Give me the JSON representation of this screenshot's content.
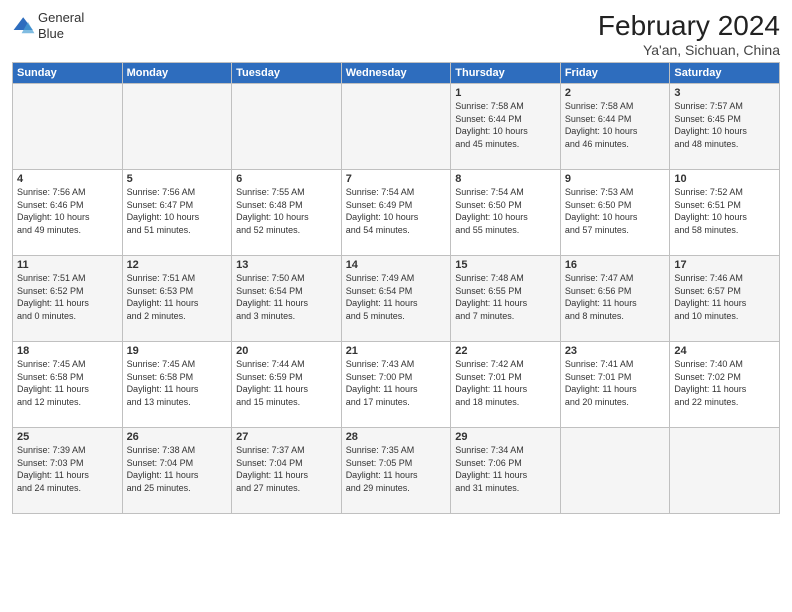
{
  "logo": {
    "line1": "General",
    "line2": "Blue"
  },
  "title": "February 2024",
  "subtitle": "Ya'an, Sichuan, China",
  "days_of_week": [
    "Sunday",
    "Monday",
    "Tuesday",
    "Wednesday",
    "Thursday",
    "Friday",
    "Saturday"
  ],
  "weeks": [
    [
      {
        "num": "",
        "info": ""
      },
      {
        "num": "",
        "info": ""
      },
      {
        "num": "",
        "info": ""
      },
      {
        "num": "",
        "info": ""
      },
      {
        "num": "1",
        "info": "Sunrise: 7:58 AM\nSunset: 6:44 PM\nDaylight: 10 hours\nand 45 minutes."
      },
      {
        "num": "2",
        "info": "Sunrise: 7:58 AM\nSunset: 6:44 PM\nDaylight: 10 hours\nand 46 minutes."
      },
      {
        "num": "3",
        "info": "Sunrise: 7:57 AM\nSunset: 6:45 PM\nDaylight: 10 hours\nand 48 minutes."
      }
    ],
    [
      {
        "num": "4",
        "info": "Sunrise: 7:56 AM\nSunset: 6:46 PM\nDaylight: 10 hours\nand 49 minutes."
      },
      {
        "num": "5",
        "info": "Sunrise: 7:56 AM\nSunset: 6:47 PM\nDaylight: 10 hours\nand 51 minutes."
      },
      {
        "num": "6",
        "info": "Sunrise: 7:55 AM\nSunset: 6:48 PM\nDaylight: 10 hours\nand 52 minutes."
      },
      {
        "num": "7",
        "info": "Sunrise: 7:54 AM\nSunset: 6:49 PM\nDaylight: 10 hours\nand 54 minutes."
      },
      {
        "num": "8",
        "info": "Sunrise: 7:54 AM\nSunset: 6:50 PM\nDaylight: 10 hours\nand 55 minutes."
      },
      {
        "num": "9",
        "info": "Sunrise: 7:53 AM\nSunset: 6:50 PM\nDaylight: 10 hours\nand 57 minutes."
      },
      {
        "num": "10",
        "info": "Sunrise: 7:52 AM\nSunset: 6:51 PM\nDaylight: 10 hours\nand 58 minutes."
      }
    ],
    [
      {
        "num": "11",
        "info": "Sunrise: 7:51 AM\nSunset: 6:52 PM\nDaylight: 11 hours\nand 0 minutes."
      },
      {
        "num": "12",
        "info": "Sunrise: 7:51 AM\nSunset: 6:53 PM\nDaylight: 11 hours\nand 2 minutes."
      },
      {
        "num": "13",
        "info": "Sunrise: 7:50 AM\nSunset: 6:54 PM\nDaylight: 11 hours\nand 3 minutes."
      },
      {
        "num": "14",
        "info": "Sunrise: 7:49 AM\nSunset: 6:54 PM\nDaylight: 11 hours\nand 5 minutes."
      },
      {
        "num": "15",
        "info": "Sunrise: 7:48 AM\nSunset: 6:55 PM\nDaylight: 11 hours\nand 7 minutes."
      },
      {
        "num": "16",
        "info": "Sunrise: 7:47 AM\nSunset: 6:56 PM\nDaylight: 11 hours\nand 8 minutes."
      },
      {
        "num": "17",
        "info": "Sunrise: 7:46 AM\nSunset: 6:57 PM\nDaylight: 11 hours\nand 10 minutes."
      }
    ],
    [
      {
        "num": "18",
        "info": "Sunrise: 7:45 AM\nSunset: 6:58 PM\nDaylight: 11 hours\nand 12 minutes."
      },
      {
        "num": "19",
        "info": "Sunrise: 7:45 AM\nSunset: 6:58 PM\nDaylight: 11 hours\nand 13 minutes."
      },
      {
        "num": "20",
        "info": "Sunrise: 7:44 AM\nSunset: 6:59 PM\nDaylight: 11 hours\nand 15 minutes."
      },
      {
        "num": "21",
        "info": "Sunrise: 7:43 AM\nSunset: 7:00 PM\nDaylight: 11 hours\nand 17 minutes."
      },
      {
        "num": "22",
        "info": "Sunrise: 7:42 AM\nSunset: 7:01 PM\nDaylight: 11 hours\nand 18 minutes."
      },
      {
        "num": "23",
        "info": "Sunrise: 7:41 AM\nSunset: 7:01 PM\nDaylight: 11 hours\nand 20 minutes."
      },
      {
        "num": "24",
        "info": "Sunrise: 7:40 AM\nSunset: 7:02 PM\nDaylight: 11 hours\nand 22 minutes."
      }
    ],
    [
      {
        "num": "25",
        "info": "Sunrise: 7:39 AM\nSunset: 7:03 PM\nDaylight: 11 hours\nand 24 minutes."
      },
      {
        "num": "26",
        "info": "Sunrise: 7:38 AM\nSunset: 7:04 PM\nDaylight: 11 hours\nand 25 minutes."
      },
      {
        "num": "27",
        "info": "Sunrise: 7:37 AM\nSunset: 7:04 PM\nDaylight: 11 hours\nand 27 minutes."
      },
      {
        "num": "28",
        "info": "Sunrise: 7:35 AM\nSunset: 7:05 PM\nDaylight: 11 hours\nand 29 minutes."
      },
      {
        "num": "29",
        "info": "Sunrise: 7:34 AM\nSunset: 7:06 PM\nDaylight: 11 hours\nand 31 minutes."
      },
      {
        "num": "",
        "info": ""
      },
      {
        "num": "",
        "info": ""
      }
    ]
  ]
}
